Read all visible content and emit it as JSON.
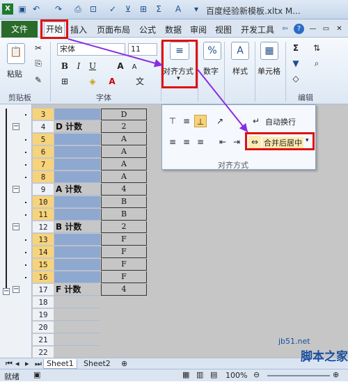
{
  "window": {
    "title": "百度经验新模板.xltx M..."
  },
  "tabs": [
    {
      "label": "文件"
    },
    {
      "label": "开始"
    },
    {
      "label": "插入"
    },
    {
      "label": "页面布局"
    },
    {
      "label": "公式"
    },
    {
      "label": "数据"
    },
    {
      "label": "审阅"
    },
    {
      "label": "视图"
    },
    {
      "label": "开发工具"
    }
  ],
  "ribbon": {
    "clipboard": {
      "paste": "粘贴",
      "group": "剪贴板"
    },
    "font": {
      "name": "宋体",
      "size": "11",
      "group": "字体",
      "bold": "B",
      "italic": "I",
      "underline": "U"
    },
    "alignment": {
      "label": "对齐方式"
    },
    "number": {
      "label": "数字",
      "symbol": "%"
    },
    "styles": {
      "label": "样式"
    },
    "cells": {
      "label": "单元格"
    },
    "editing": {
      "group": "编辑"
    }
  },
  "popup": {
    "wrap_label": "自动换行",
    "merge_label": "合并后居中",
    "group_label": "对齐方式"
  },
  "rows": [
    {
      "num": "3",
      "a": "",
      "b": "D",
      "sel": true
    },
    {
      "num": "4",
      "a": "D 计数",
      "b": "2",
      "sel": false
    },
    {
      "num": "5",
      "a": "",
      "b": "A",
      "sel": true
    },
    {
      "num": "6",
      "a": "",
      "b": "A",
      "sel": true
    },
    {
      "num": "7",
      "a": "",
      "b": "A",
      "sel": true
    },
    {
      "num": "8",
      "a": "",
      "b": "A",
      "sel": true
    },
    {
      "num": "9",
      "a": "A 计数",
      "b": "4",
      "sel": false
    },
    {
      "num": "10",
      "a": "",
      "b": "B",
      "sel": true
    },
    {
      "num": "11",
      "a": "",
      "b": "B",
      "sel": true
    },
    {
      "num": "12",
      "a": "B 计数",
      "b": "2",
      "sel": false
    },
    {
      "num": "13",
      "a": "",
      "b": "F",
      "sel": true
    },
    {
      "num": "14",
      "a": "",
      "b": "F",
      "sel": true
    },
    {
      "num": "15",
      "a": "",
      "b": "F",
      "sel": true
    },
    {
      "num": "16",
      "a": "",
      "b": "F",
      "sel": true
    },
    {
      "num": "17",
      "a": "F 计数",
      "b": "4",
      "sel": false
    },
    {
      "num": "18",
      "a": "",
      "b": "",
      "sel": false
    },
    {
      "num": "19",
      "a": "",
      "b": "",
      "sel": false
    },
    {
      "num": "20",
      "a": "",
      "b": "",
      "sel": false
    },
    {
      "num": "21",
      "a": "",
      "b": "",
      "sel": false
    },
    {
      "num": "22",
      "a": "",
      "b": "",
      "sel": false
    },
    {
      "num": "23",
      "a": "",
      "b": "",
      "sel": false
    }
  ],
  "sheets": [
    {
      "label": "Sheet1"
    },
    {
      "label": "Sheet2"
    }
  ],
  "status": {
    "ready": "就绪",
    "zoom": "100%"
  },
  "watermark": {
    "line1": "jb51.net",
    "line2": "脚本之家"
  },
  "colors": {
    "accent": "#2a6a2a",
    "highlight": "#e01010",
    "arrow": "#8a2be2"
  }
}
